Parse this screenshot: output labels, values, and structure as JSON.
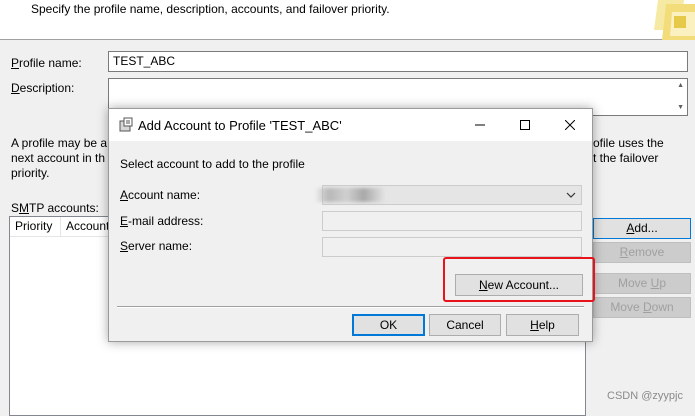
{
  "wizard": {
    "header_text": "Specify the profile name, description, accounts, and failover priority.",
    "profile_name_label_u": "P",
    "profile_name_label_rest": "rofile name:",
    "profile_name_value": "TEST_ABC",
    "description_label_u": "D",
    "description_label_rest": "escription:",
    "info_left_line1": "A profile may be a",
    "info_left_line2": "next account in th",
    "info_left_line3": "priority.",
    "info_right_line1": "ofile uses the",
    "info_right_line2": "t the failover",
    "smtp_label_pre": "S",
    "smtp_label_u": "M",
    "smtp_label_rest": "TP accounts:",
    "columns": [
      "Priority",
      "Account"
    ],
    "buttons": {
      "add": "Add...",
      "remove": "Remove",
      "move_up": "Move Up",
      "move_down": "Move Down"
    }
  },
  "dialog": {
    "title": "Add Account to Profile 'TEST_ABC'",
    "prompt": "Select account to add to the profile",
    "account_name_label_u": "A",
    "account_name_label_rest": "ccount name:",
    "email_label_u": "E",
    "email_label_rest": "-mail address:",
    "server_label_u": "S",
    "server_label_rest": "erver name:",
    "new_account_u": "N",
    "new_account_rest": "ew Account...",
    "ok": "OK",
    "cancel": "Cancel",
    "help_u": "H",
    "help_rest": "elp"
  },
  "watermark": "CSDN @zyypjc",
  "colors": {
    "highlight": "#e8121c",
    "accent": "#0078d7"
  }
}
